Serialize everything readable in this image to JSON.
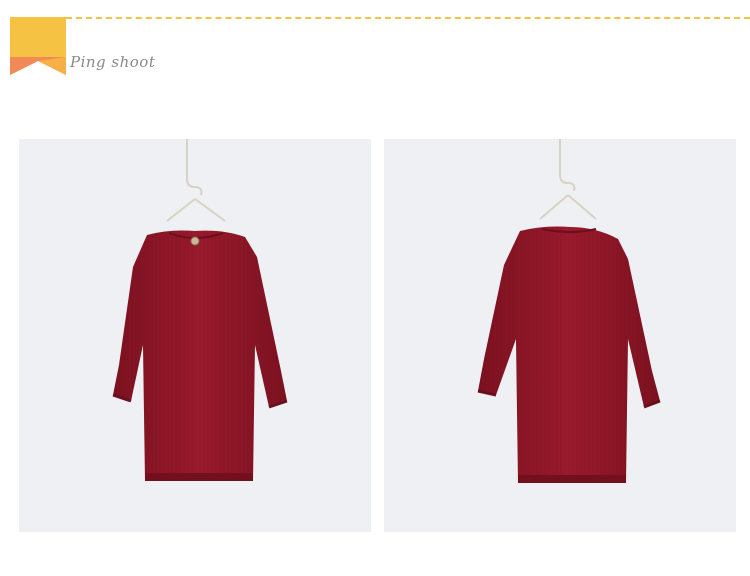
{
  "section": {
    "title": "Ping shoot"
  },
  "colors": {
    "accent_yellow": "#f6c243",
    "accent_orange": "#f28a57",
    "photo_bg": "#eff0f3",
    "garment": "#8e1526"
  },
  "photos": [
    {
      "view": "front",
      "icon": "sweater-dress-front-photo"
    },
    {
      "view": "back",
      "icon": "sweater-dress-back-photo"
    }
  ]
}
